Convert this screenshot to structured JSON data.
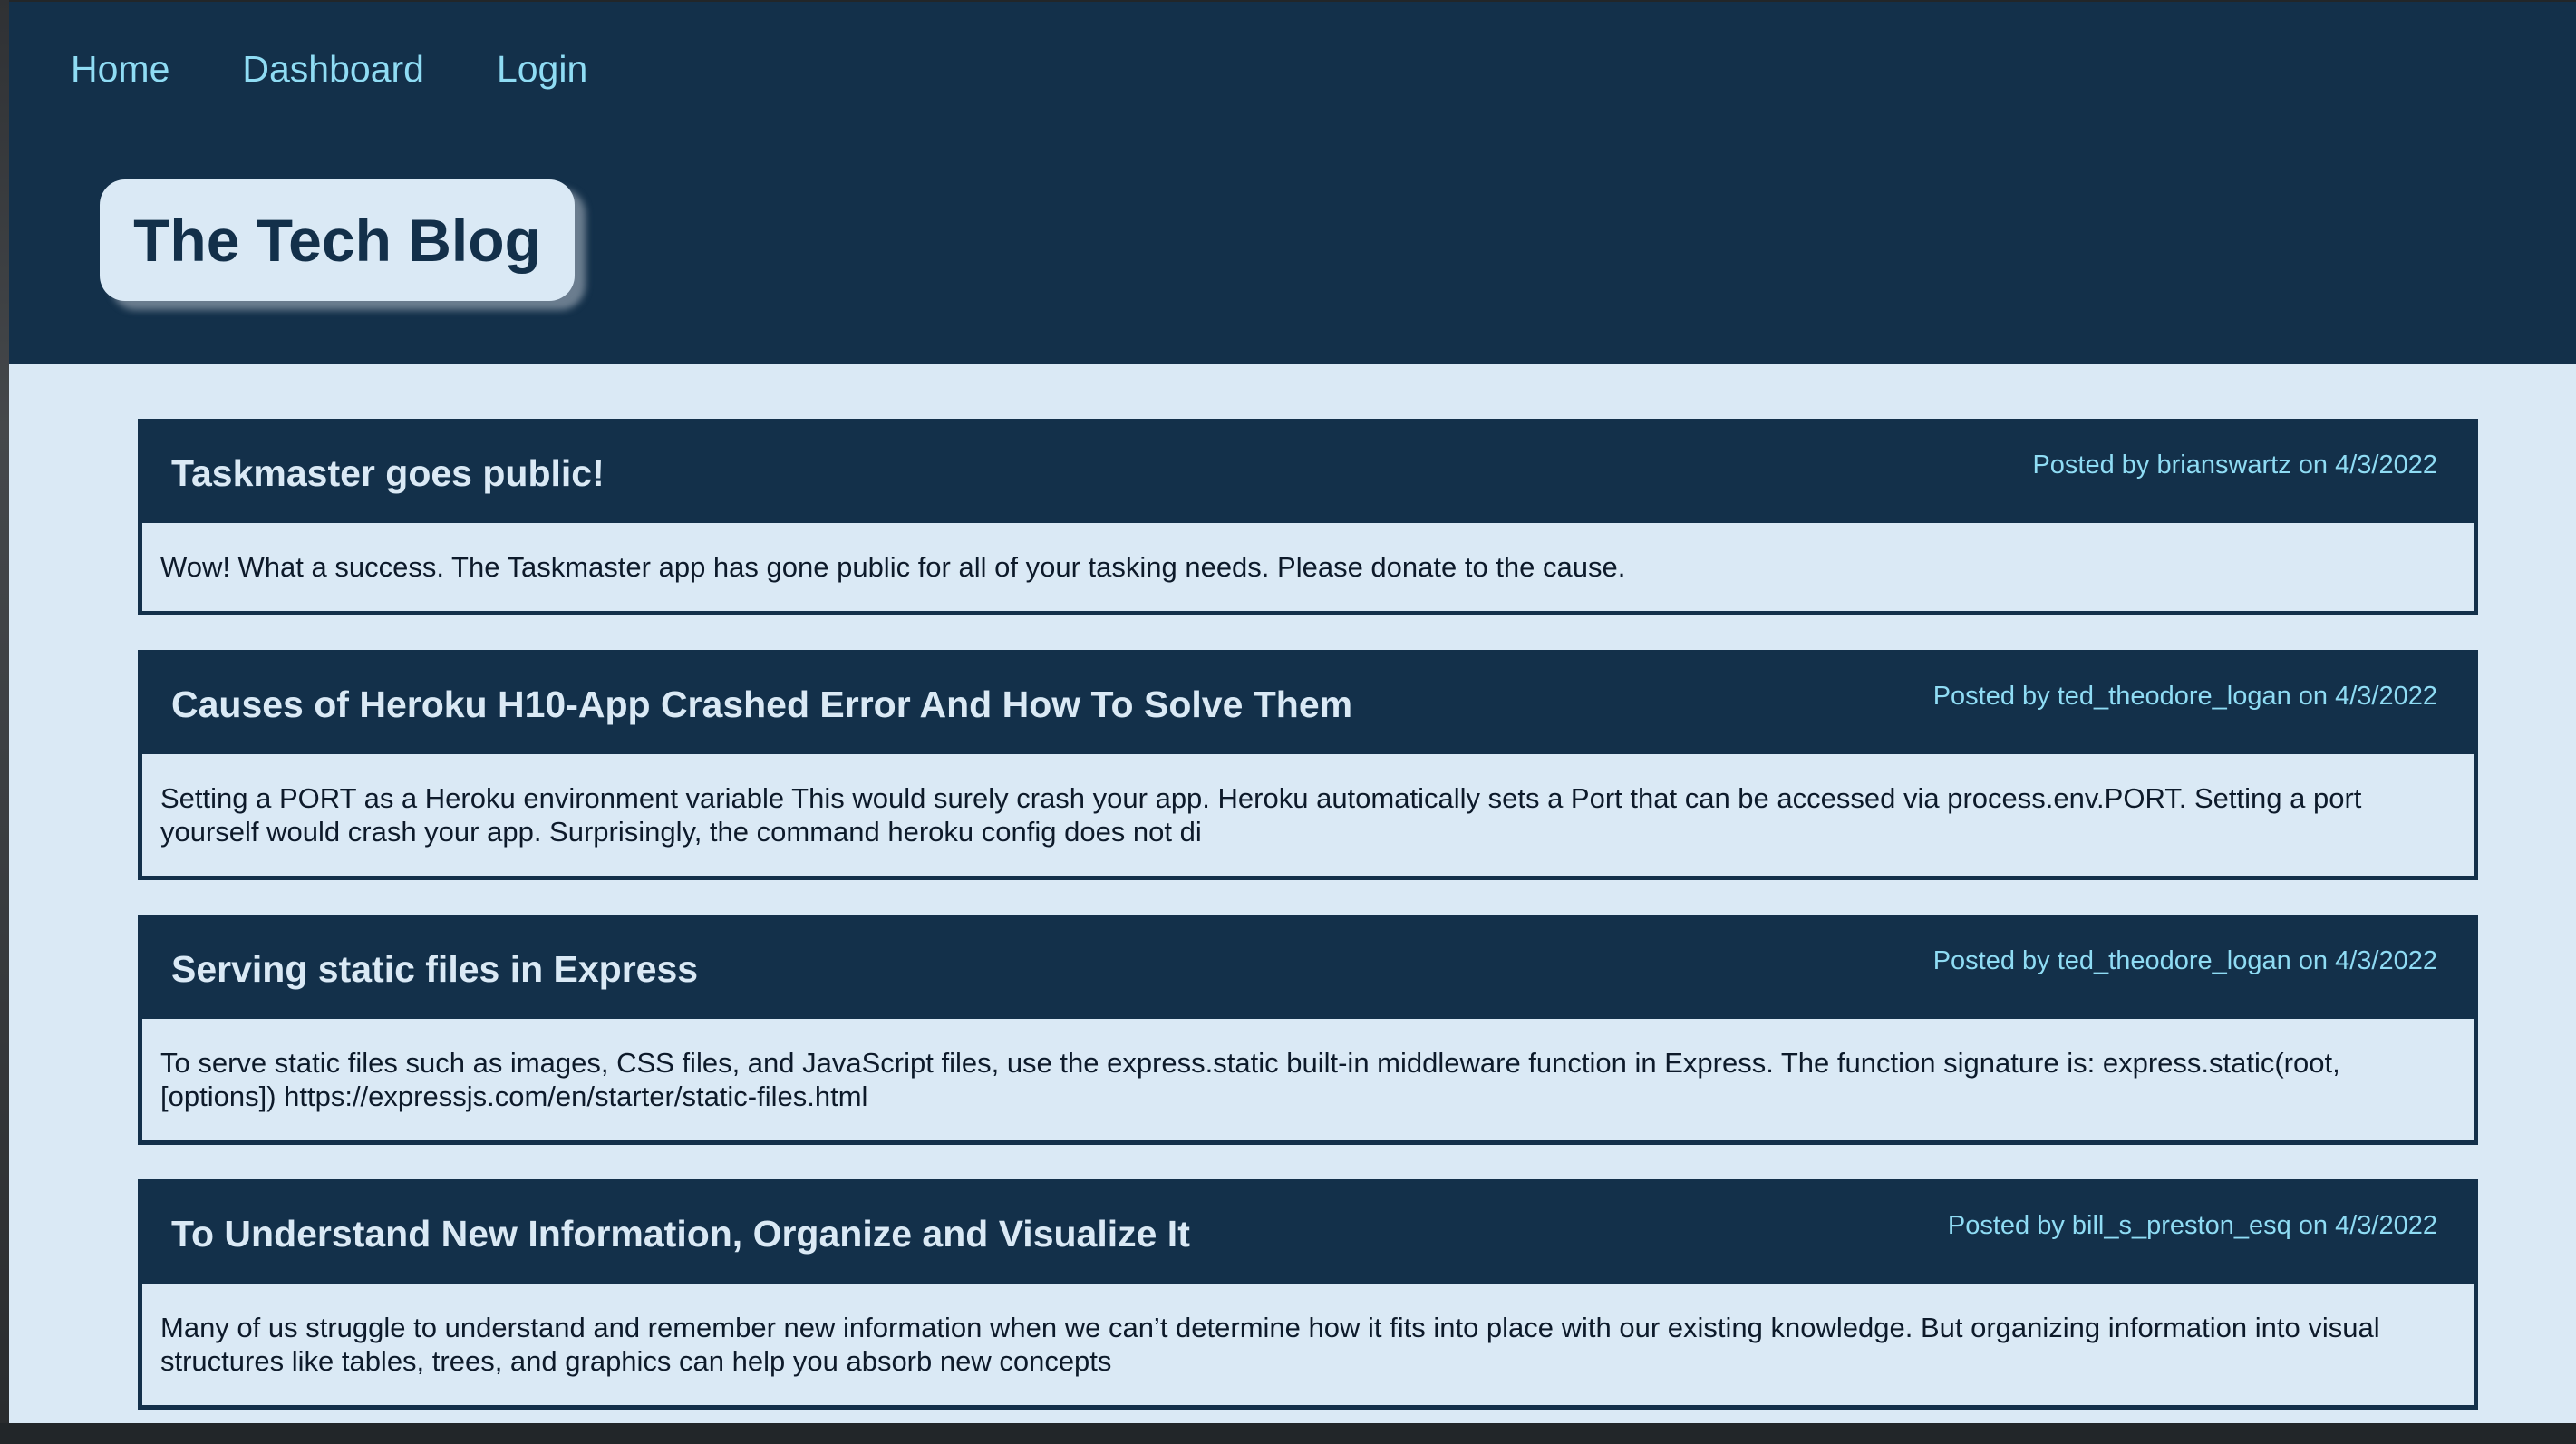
{
  "nav": {
    "home": "Home",
    "dashboard": "Dashboard",
    "login": "Login"
  },
  "header": {
    "title": "The Tech Blog"
  },
  "colors": {
    "header_bg": "#13304a",
    "page_bg": "#dae9f5",
    "link": "#8fdcf4"
  },
  "posts": [
    {
      "title": "Taskmaster goes public!",
      "meta": "Posted by brianswartz on 4/3/2022",
      "body": "Wow! What a success. The Taskmaster app has gone public for all of your tasking needs. Please donate to the cause."
    },
    {
      "title": "Causes of Heroku H10-App Crashed Error And How To Solve Them",
      "meta": "Posted by ted_theodore_logan on 4/3/2022",
      "body": "Setting a PORT as a Heroku environment variable This would surely crash your app. Heroku automatically sets a Port that can be accessed via process.env.PORT. Setting a port yourself would crash your app. Surprisingly, the command heroku config does not di"
    },
    {
      "title": "Serving static files in Express",
      "meta": "Posted by ted_theodore_logan on 4/3/2022",
      "body": "To serve static files such as images, CSS files, and JavaScript files, use the express.static built-in middleware function in Express. The function signature is: express.static(root, [options]) https://expressjs.com/en/starter/static-files.html"
    },
    {
      "title": "To Understand New Information, Organize and Visualize It",
      "meta": "Posted by bill_s_preston_esq on 4/3/2022",
      "body": "Many of us struggle to understand and remember new information when we can’t determine how it fits into place with our existing knowledge. But organizing information into visual structures like tables, trees, and graphics can help you absorb new concepts"
    }
  ]
}
